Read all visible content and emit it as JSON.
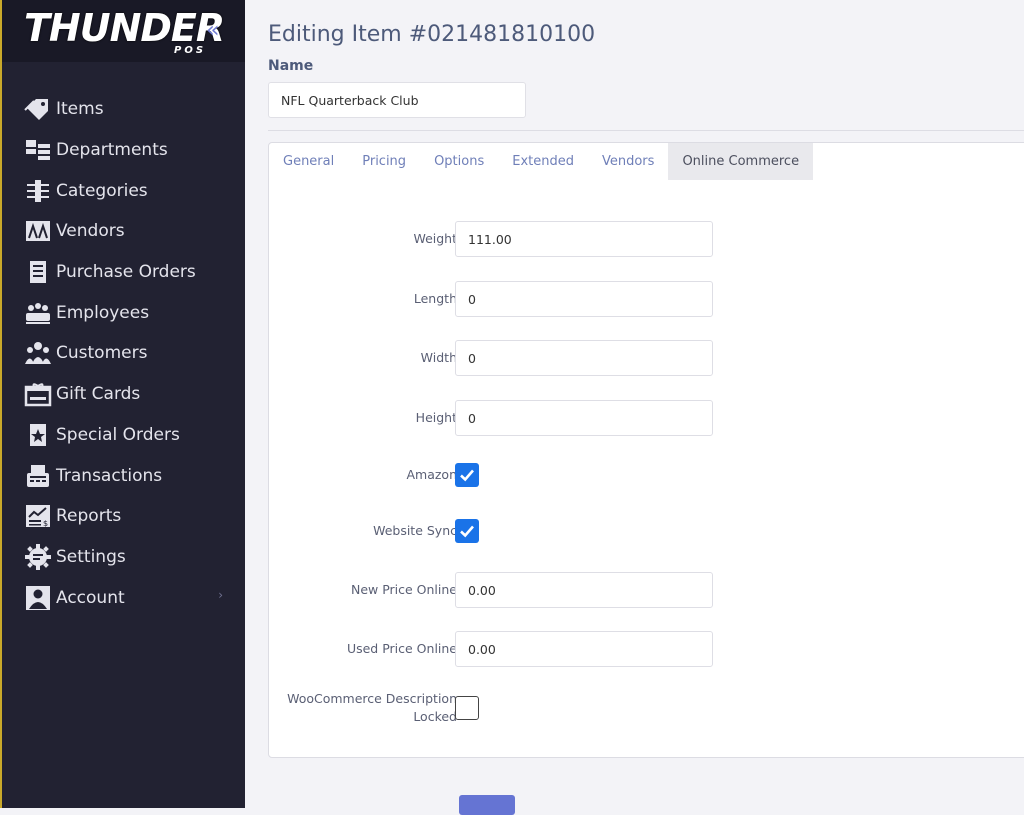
{
  "brand": {
    "logo_text": "THUNDER",
    "logo_sub": "POS",
    "collapse_glyph": "«"
  },
  "sidebar": {
    "items": [
      {
        "label": "Items",
        "icon": "tag-icon"
      },
      {
        "label": "Departments",
        "icon": "departments-icon"
      },
      {
        "label": "Categories",
        "icon": "categories-icon"
      },
      {
        "label": "Vendors",
        "icon": "vendors-icon"
      },
      {
        "label": "Purchase Orders",
        "icon": "purchase-orders-icon"
      },
      {
        "label": "Employees",
        "icon": "employees-icon"
      },
      {
        "label": "Customers",
        "icon": "customers-icon"
      },
      {
        "label": "Gift Cards",
        "icon": "gift-card-icon"
      },
      {
        "label": "Special Orders",
        "icon": "special-orders-icon"
      },
      {
        "label": "Transactions",
        "icon": "transactions-icon"
      },
      {
        "label": "Reports",
        "icon": "reports-icon"
      },
      {
        "label": "Settings",
        "icon": "gear-icon"
      },
      {
        "label": "Account",
        "icon": "account-icon",
        "has_arrow": true
      }
    ],
    "arrow_glyph": "›"
  },
  "main": {
    "title": "Editing Item #021481810100",
    "name_label": "Name",
    "name_value": "NFL Quarterback Club",
    "tabs": [
      {
        "label": "General",
        "active": false
      },
      {
        "label": "Pricing",
        "active": false
      },
      {
        "label": "Options",
        "active": false
      },
      {
        "label": "Extended",
        "active": false
      },
      {
        "label": "Vendors",
        "active": false
      },
      {
        "label": "Online Commerce",
        "active": true
      }
    ],
    "fields": {
      "weight": {
        "label": "Weight",
        "value": "111.00"
      },
      "length": {
        "label": "Length",
        "value": "0"
      },
      "width": {
        "label": "Width",
        "value": "0"
      },
      "height": {
        "label": "Height",
        "value": "0"
      },
      "amazon": {
        "label": "Amazon",
        "checked": true
      },
      "website_sync": {
        "label": "Website Sync",
        "checked": true
      },
      "new_price_online": {
        "label": "New Price Online",
        "value": "0.00"
      },
      "used_price_online": {
        "label": "Used Price Online",
        "value": "0.00"
      },
      "woo_desc_locked": {
        "label_line1": "WooCommerce Description",
        "label_line2": "Locked",
        "checked": false
      }
    }
  },
  "colors": {
    "sidebar_bg": "#222232",
    "accent": "#6574d3",
    "checkbox_checked": "#1a73e8"
  }
}
